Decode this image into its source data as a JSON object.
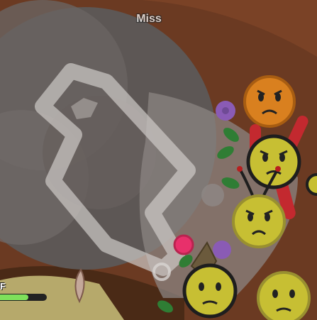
{
  "hud": {
    "float_text": "Miss",
    "partial_label": "F",
    "player_health_fraction": 0.6
  },
  "colors": {
    "background_dirt": "#6b3a22",
    "rock": "#5d5755",
    "trail": "#cfcac8",
    "mob_yellow": "#c7bf33",
    "mob_orange": "#d9801f",
    "petal_pink": "#e8306b",
    "flower_purple": "#8a5bb5"
  },
  "entities": [
    {
      "kind": "mob-face",
      "mood": "angry",
      "color": "orange"
    },
    {
      "kind": "mob-face",
      "mood": "angry",
      "color": "yellow"
    },
    {
      "kind": "mob-face",
      "mood": "angry",
      "color": "yellow"
    },
    {
      "kind": "mob-face",
      "mood": "sad",
      "color": "yellow"
    },
    {
      "kind": "mob-face",
      "mood": "sad",
      "color": "yellow"
    }
  ]
}
